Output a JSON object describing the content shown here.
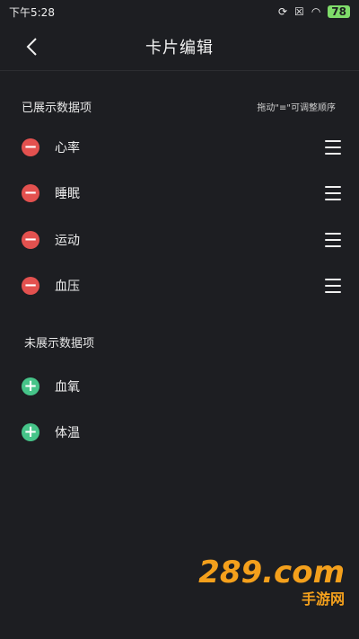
{
  "status_bar": {
    "time": "下午5:28",
    "battery": "78"
  },
  "header": {
    "title": "卡片编辑"
  },
  "shown": {
    "title": "已展示数据项",
    "hint": "拖动\"≡\"可调整顺序",
    "items": [
      {
        "label": "心率"
      },
      {
        "label": "睡眠"
      },
      {
        "label": "运动"
      },
      {
        "label": "血压"
      }
    ]
  },
  "hidden": {
    "title": "未展示数据项",
    "items": [
      {
        "label": "血氧"
      },
      {
        "label": "体温"
      }
    ]
  },
  "watermark": {
    "main": "289.com",
    "sub": "手游网"
  },
  "colors": {
    "background": "#1d1e22",
    "remove": "#e3514f",
    "add": "#46c489"
  }
}
